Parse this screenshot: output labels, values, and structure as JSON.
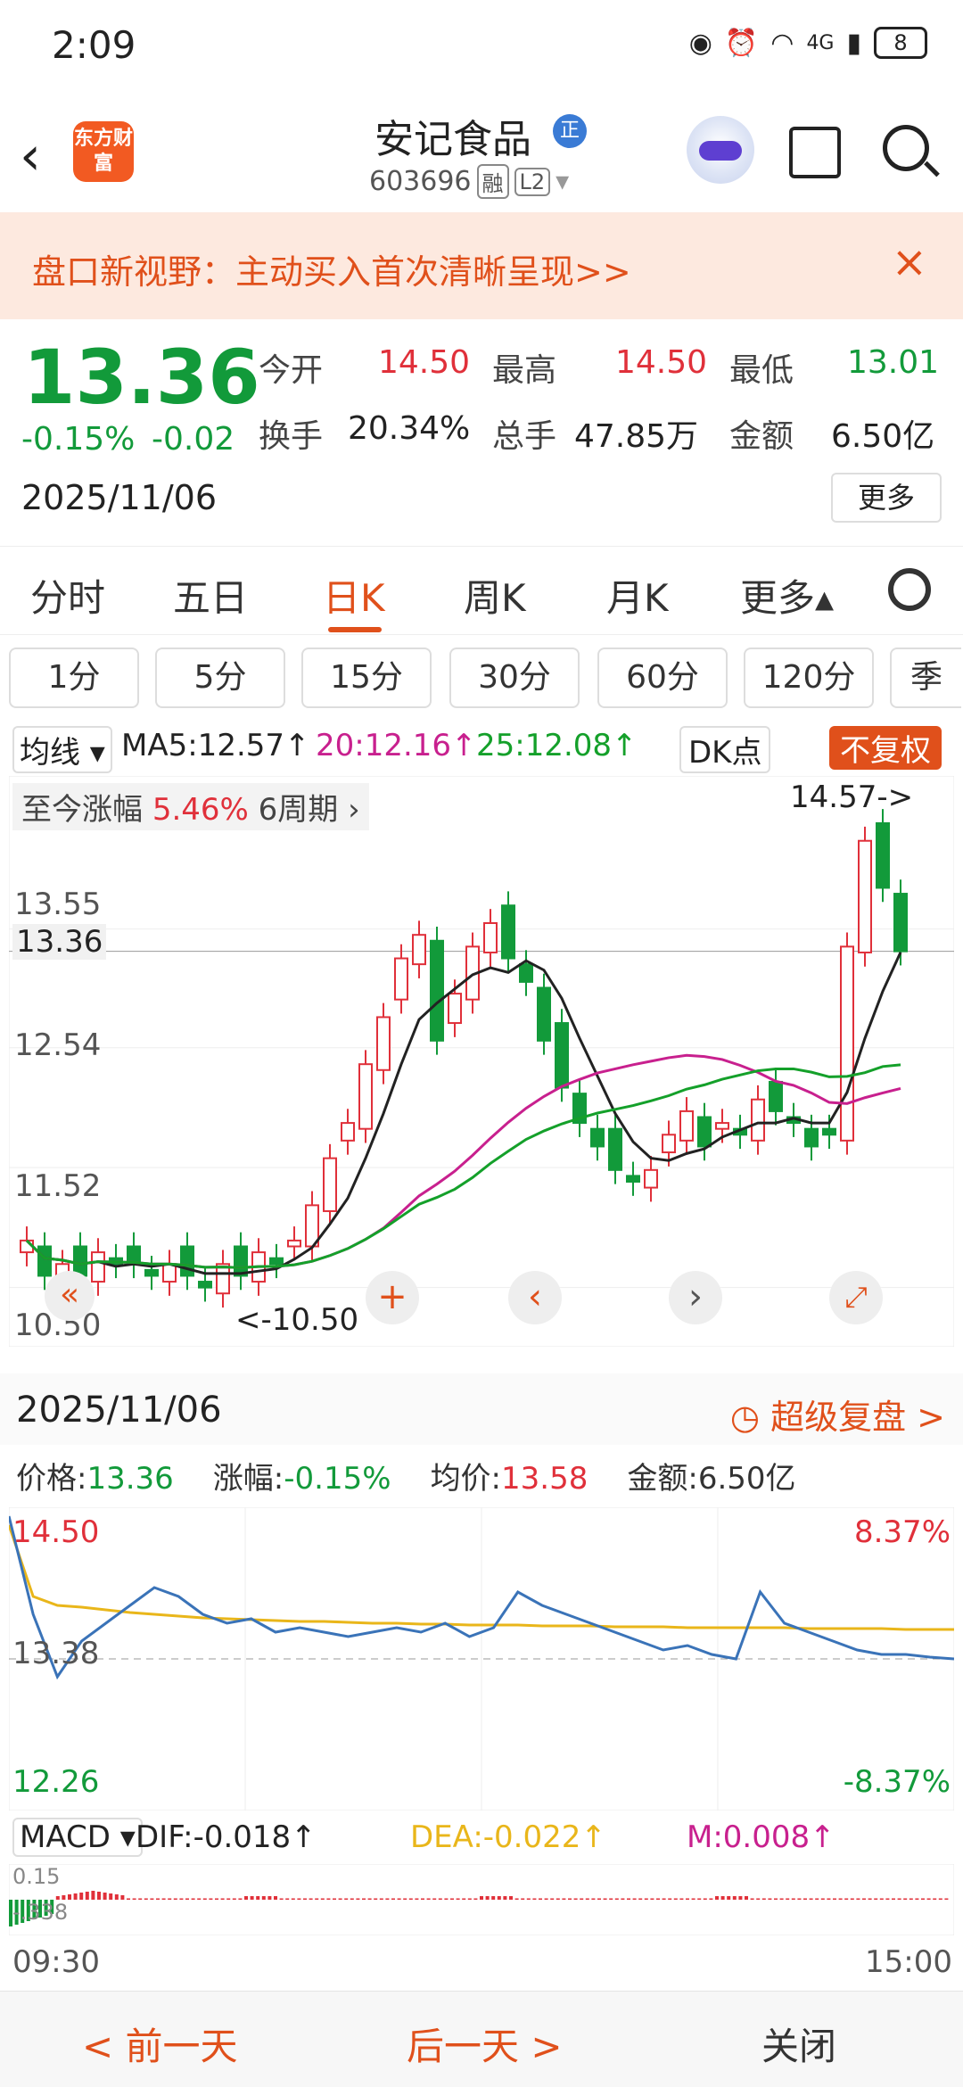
{
  "status": {
    "time": "2:09",
    "battery": "8",
    "signal": "4G"
  },
  "nav": {
    "stock_name": "安记食品",
    "badge": "正",
    "code": "603696",
    "tag1": "融",
    "tag2": "L2",
    "logo_text": "东方财富"
  },
  "banner": {
    "text": "盘口新视野：主动买入首次清晰呈现>>",
    "close": "×"
  },
  "quote": {
    "price": "13.36",
    "change_pct": "-0.15%",
    "change": "-0.02",
    "date": "2025/11/06",
    "open_label": "今开",
    "open": "14.50",
    "high_label": "最高",
    "high": "14.50",
    "low_label": "最低",
    "low": "13.01",
    "turnover_label": "换手",
    "turnover": "20.34%",
    "volume_label": "总手",
    "volume": "47.85万",
    "amount_label": "金额",
    "amount": "6.50亿",
    "more": "更多"
  },
  "tabs": [
    "分时",
    "五日",
    "日K",
    "周K",
    "月K",
    "更多▴"
  ],
  "periods": [
    "1分",
    "5分",
    "15分",
    "30分",
    "60分",
    "120分",
    "季"
  ],
  "ma": {
    "selector": "均线",
    "ma5": "MA5:12.57↑",
    "ma20": "20:12.16↑",
    "ma25": "25:12.08↑",
    "dk": "DK点",
    "fq": "不复权"
  },
  "kchart_labels": {
    "rise": "至今涨幅",
    "rise_val": "5.46%",
    "period": "6周期",
    "y1": "13.55",
    "y2": "12.54",
    "y3": "11.52",
    "y4": "10.50",
    "cur": "13.36",
    "hi": "14.57",
    "lo": "10.50"
  },
  "detail": {
    "date": "2025/11/06",
    "fupan": "超级复盘 >",
    "price_label": "价格:",
    "price": "13.36",
    "chg_label": "涨幅:",
    "chg": "-0.15%",
    "avg_label": "均价:",
    "avg": "13.58",
    "amt_label": "金额:",
    "amt": "6.50亿"
  },
  "tchart_labels": {
    "top": "14.50",
    "mid": "13.38",
    "bot": "12.26",
    "top_pct": "8.37%",
    "bot_pct": "-8.37%",
    "start": "09:30",
    "end": "15:00"
  },
  "macd": {
    "name": "MACD",
    "dif": "DIF:-0.018↑",
    "dea": "DEA:-0.022↑",
    "m": "M:0.008↑",
    "v1": "0.15",
    "v2": "-.338"
  },
  "footer": {
    "prev": "< 前一天",
    "next": "后一天 >",
    "close": "关闭"
  },
  "colors": {
    "up": "#e0303a",
    "down": "#129a3a",
    "accent": "#e0501b",
    "ma5": "#222222",
    "ma20": "#c8208e",
    "ma25": "#14a02a"
  },
  "chart_data": {
    "type": "candlestick",
    "ylim": [
      10.3,
      14.7
    ],
    "closes": [
      10.9,
      10.6,
      10.7,
      10.6,
      10.8,
      10.7,
      10.7,
      10.6,
      10.7,
      10.6,
      10.5,
      10.7,
      10.6,
      10.8,
      10.7,
      10.9,
      11.2,
      11.6,
      11.9,
      12.4,
      12.8,
      13.3,
      13.5,
      12.6,
      13.0,
      13.4,
      13.6,
      13.3,
      13.1,
      12.6,
      12.2,
      11.9,
      11.7,
      11.5,
      11.4,
      11.5,
      11.8,
      12.0,
      11.7,
      11.9,
      11.8,
      12.1,
      12.0,
      11.9,
      11.7,
      11.8,
      13.4,
      14.3,
      13.9,
      13.36
    ],
    "ma5_end": 12.57,
    "ma20_end": 12.16,
    "ma25_end": 12.08
  }
}
